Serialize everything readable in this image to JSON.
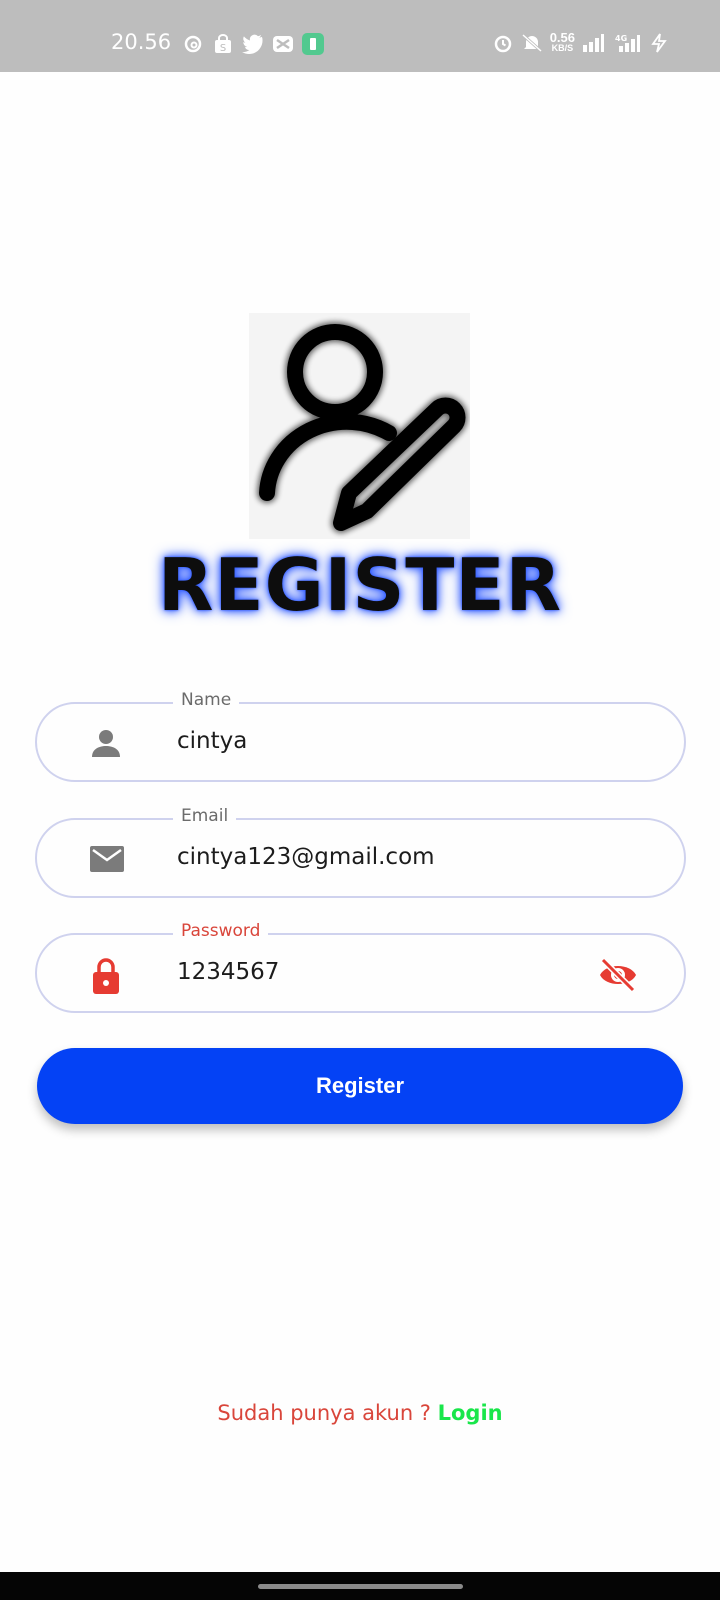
{
  "status_bar": {
    "time": "20.56",
    "net_speed": "0.56",
    "net_unit": "KB/S",
    "network": "4G",
    "left_icons": [
      "threads-icon",
      "shop-bag-icon",
      "twitter-icon",
      "capcut-icon",
      "app-green-icon"
    ],
    "right_icons": [
      "alarm-icon",
      "mute-icon",
      "signal-icon",
      "signal-4g-icon",
      "charging-icon"
    ]
  },
  "screen": {
    "title": "REGISTER",
    "logo_icon": "user-edit-icon"
  },
  "form": {
    "name": {
      "label": "Name",
      "value": "cintya",
      "icon": "person-icon"
    },
    "email": {
      "label": "Email",
      "value": "cintya123@gmail.com",
      "icon": "mail-icon"
    },
    "password": {
      "label": "Password",
      "value": "1234567",
      "icon": "lock-icon",
      "toggle_icon": "eye-off-icon"
    },
    "submit_label": "Register"
  },
  "footer": {
    "prompt": "Sudah punya akun ? ",
    "link_label": "Login"
  },
  "colors": {
    "accent": "#0442f5",
    "error": "#d9453a",
    "link": "#19e64a",
    "outline": "#cfd2ee"
  }
}
